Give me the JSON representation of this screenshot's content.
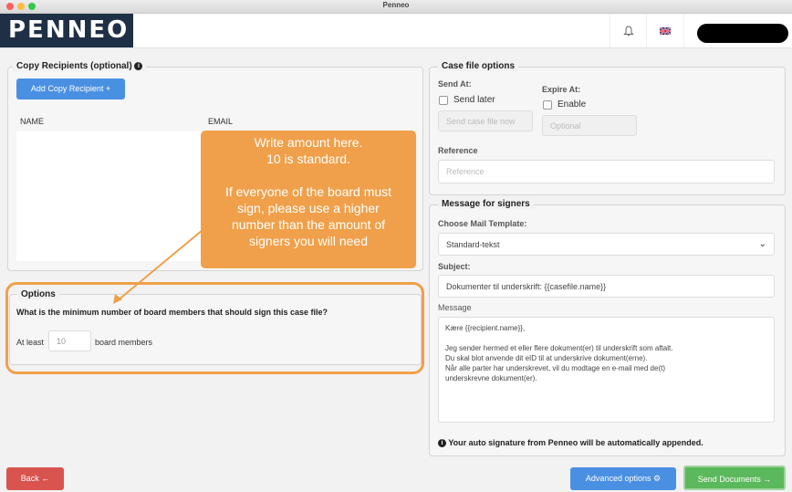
{
  "window": {
    "title": "Penneo"
  },
  "header": {
    "logo": "PENNEO",
    "bell_icon": "bell-icon",
    "flag_icon": "uk-flag-icon"
  },
  "copy_recipients": {
    "title": "Copy Recipients (optional)",
    "add_button": "Add Copy Recipient  +",
    "columns": [
      "NAME",
      "EMAIL"
    ]
  },
  "options": {
    "title": "Options",
    "question": "What is the minimum number of board members that should sign this case file?",
    "prefix": "At least",
    "value": "10",
    "suffix": "board members"
  },
  "callout": {
    "line1": "Write amount here.",
    "line2": "10 is standard.",
    "line3": "If everyone of the board must",
    "line4": "sign, please use a higher",
    "line5": "number than the amount of",
    "line6": "signers you will need"
  },
  "case_file_options": {
    "title": "Case file options",
    "send_at_label": "Send At:",
    "send_later": "Send later",
    "send_now_placeholder": "Send case file now",
    "expire_label": "Expire At:",
    "enable": "Enable",
    "optional_placeholder": "Optional",
    "reference_label": "Reference",
    "reference_placeholder": "Reference"
  },
  "message_signers": {
    "title": "Message for signers",
    "template_label": "Choose Mail Template:",
    "template_value": "Standard-tekst",
    "subject_label": "Subject:",
    "subject_value": "Dokumenter til underskrift: {{casefile.name}}",
    "message_label": "Message",
    "message_lines": [
      "Kære {{recipient.name}},",
      "",
      "Jeg sender hermed et eller flere dokument(er) til underskrift som aftalt.",
      "Du skal blot anvende dit eID til at underskrive dokument(erne).",
      "Når alle parter har underskrevet, vil du modtage en e-mail med de(t)",
      "underskrevne dokument(er)."
    ],
    "auto_signature": "Your auto signature from Penneo will be automatically appended."
  },
  "footer": {
    "back": "Back",
    "advanced": "Advanced options",
    "send": "Send Documents"
  },
  "colors": {
    "blue": "#4a90e2",
    "green": "#5cb85c",
    "red": "#d9534f",
    "orange": "#f0a04a",
    "navy": "#1f3046"
  }
}
